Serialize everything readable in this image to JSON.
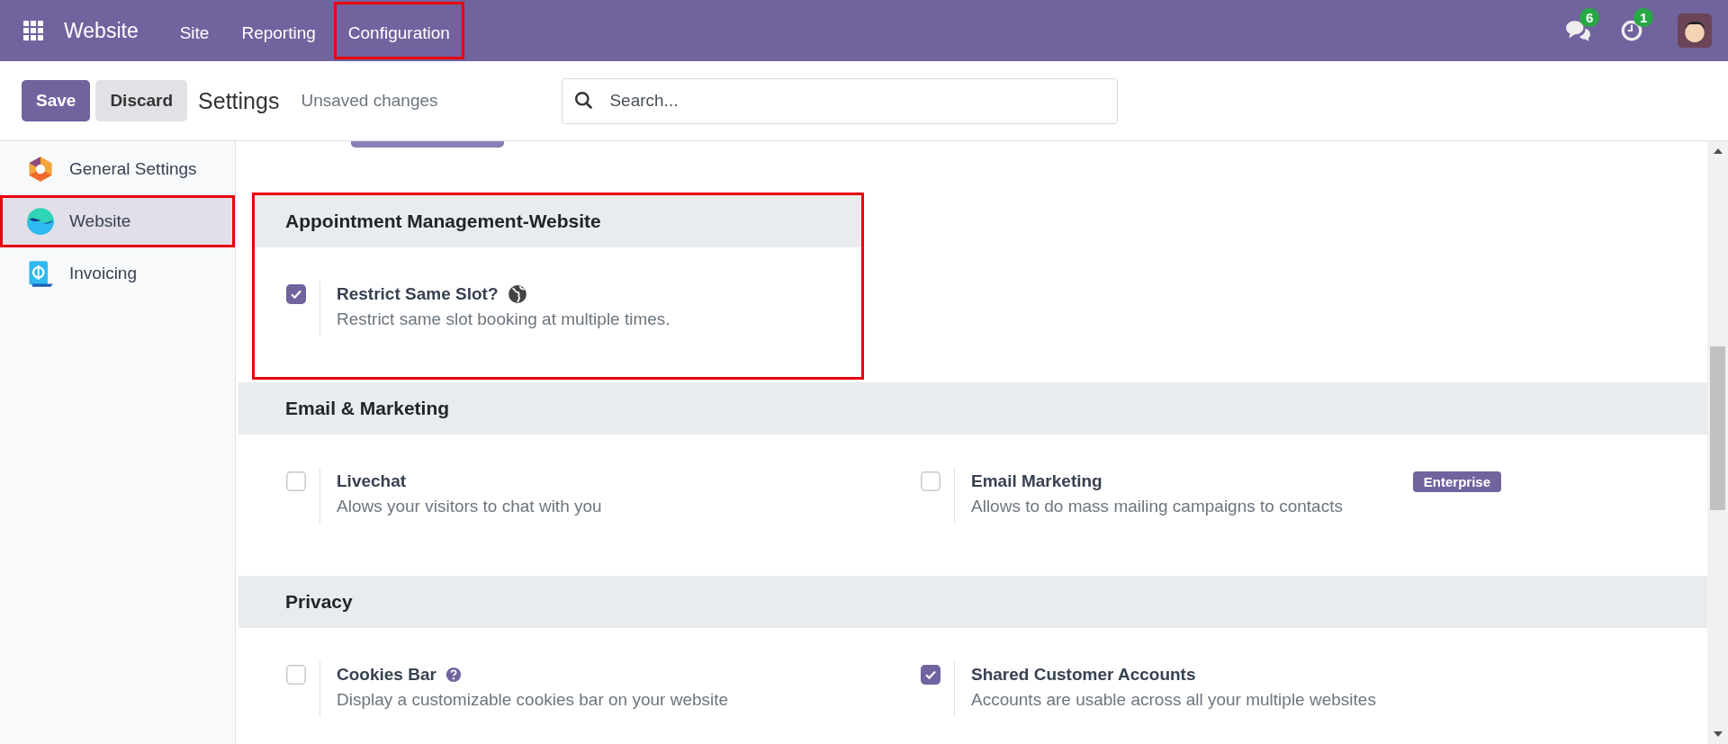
{
  "topbar": {
    "app": "Website",
    "menu": [
      {
        "label": "Site",
        "highlighted": false
      },
      {
        "label": "Reporting",
        "highlighted": false
      },
      {
        "label": "Configuration",
        "highlighted": true
      }
    ],
    "messages_count": "6",
    "activities_count": "1"
  },
  "controlbar": {
    "save": "Save",
    "discard": "Discard",
    "title": "Settings",
    "status": "Unsaved changes",
    "search": {
      "placeholder": "Search..."
    }
  },
  "sidebar": {
    "items": [
      {
        "label": "General Settings",
        "kind": "general",
        "selected": false,
        "highlighted": false
      },
      {
        "label": "Website",
        "kind": "website",
        "selected": true,
        "highlighted": true
      },
      {
        "label": "Invoicing",
        "kind": "invoicing",
        "selected": false,
        "highlighted": false
      }
    ]
  },
  "sections": [
    {
      "title": "Appointment Management-Website",
      "highlighted": true,
      "settings": [
        {
          "title": "Restrict Same Slot?",
          "description": "Restrict same slot booking at multiple times.",
          "checked": true,
          "kind": "globe"
        }
      ]
    },
    {
      "title": "Email & Marketing",
      "highlighted": false,
      "settings": [
        {
          "title": "Livechat",
          "description": "Alows your visitors to chat with you",
          "checked": false
        },
        {
          "title": "Email Marketing",
          "description": "Allows to do mass mailing campaigns to contacts",
          "checked": false,
          "badge": "Enterprise"
        }
      ]
    },
    {
      "title": "Privacy",
      "highlighted": false,
      "settings": [
        {
          "title": "Cookies Bar",
          "description": "Display a customizable cookies bar on your website",
          "checked": false,
          "kind": "help"
        },
        {
          "title": "Shared Customer Accounts",
          "description": "Accounts are usable across all your multiple websites",
          "checked": true
        }
      ]
    }
  ]
}
